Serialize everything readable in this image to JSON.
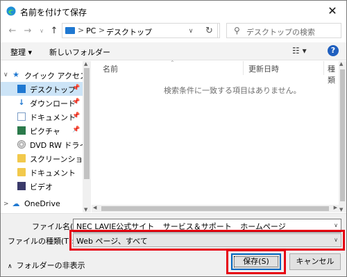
{
  "window": {
    "title": "名前を付けて保存"
  },
  "nav": {
    "address_segments": [
      "PC",
      "デスクトップ"
    ],
    "search_placeholder": "デスクトップの検索"
  },
  "toolbar": {
    "organize": "整理 ▾",
    "new_folder": "新しいフォルダー"
  },
  "sidebar": {
    "items": [
      {
        "label": "クイック アクセス",
        "icon": "star-icon",
        "expanded": true
      },
      {
        "label": "デスクトップ",
        "icon": "desktop-icon",
        "pinned": true,
        "selected": true
      },
      {
        "label": "ダウンロード",
        "icon": "download-icon",
        "pinned": true
      },
      {
        "label": "ドキュメント",
        "icon": "document-icon",
        "pinned": true
      },
      {
        "label": "ピクチャ",
        "icon": "pictures-icon",
        "pinned": true
      },
      {
        "label": "DVD RW ドライブ (",
        "icon": "dvd-drive-icon"
      },
      {
        "label": "スクリーンショット",
        "icon": "folder-icon"
      },
      {
        "label": "ドキュメント",
        "icon": "folder-icon"
      },
      {
        "label": "ビデオ",
        "icon": "video-icon"
      },
      {
        "label": "OneDrive",
        "icon": "cloud-icon"
      }
    ]
  },
  "list": {
    "columns": [
      "名前",
      "更新日時",
      "種類"
    ],
    "empty_message": "検索条件に一致する項目はありません。"
  },
  "form": {
    "filename_label": "ファイル名(N):",
    "filename_value": "NEC LAVIE公式サイト _ サービス＆サポート _ ホームページ",
    "filetype_label": "ファイルの種類(T):",
    "filetype_value": "Web ページ、すべて",
    "hide_folders": "フォルダーの非表示",
    "save": "保存(S)",
    "cancel": "キャンセル"
  },
  "colors": {
    "highlight": "#e60012",
    "selection": "#cce4f7",
    "accent": "#0067c0"
  }
}
